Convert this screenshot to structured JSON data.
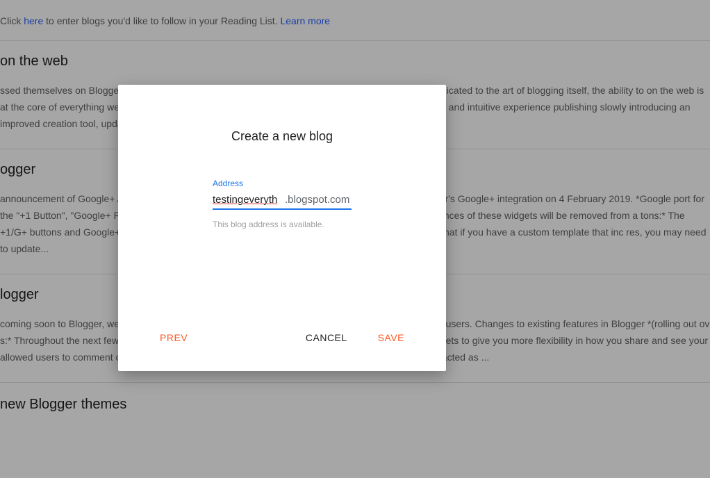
{
  "bg": {
    "hint_pre": "Click ",
    "hint_here": "here",
    "hint_mid": " to enter blogs you'd like to follow in your Reading List. ",
    "hint_learn": "Learn more",
    "h1": "on the web",
    "p1": "ssed themselves on Blogger. From detailing the simplicities of a quiet home down the lane to a blog dedicated to the art of blogging itself, the ability to on the web is at the core of everything we do. We want to make sure that whoever you are using Blogger has an easy and intuitive experience publishing slowly introducing an improved creation tool, updated settings, and a cleaner workspace. Try the New Blog...",
    "h2": "ogger",
    "p2": "announcement of Google+ APIs being shutdown, we'll be making a number of changes made to Blogger's Google+ integration on 4 February 2019. *Google port for the \"+1 Button\", \"Google+ Followers\" and \"Google+ Badge\" widgets will no longer be available. All instances of these widgets will be removed from a tons:* The +1/G+ buttons and Google+ footer share links will also be removed. These will be moved. Please note that if you have a custom template that inc res, you may need to update...",
    "h3": "logger",
    "p3": "coming soon to Blogger, we're simplifying the platform to enhance the blogging experience for all of our users. Changes to existing features in Blogger *(rolling out ov s:* Throughout the next few months, Blogger will transform Google+ widget integrations into HTML widgets to give you more flexibility in how you share and see your allowed users to comment on blogs using an existing third party OpenID identity provider and has also acted as ...",
    "h4": "new Blogger themes"
  },
  "dialog": {
    "title": "Create a new blog",
    "field_label": "Address",
    "input_value": "testingeveryth",
    "suffix": ".blogspot.com",
    "helper": "This blog address is available.",
    "prev": "PREV",
    "cancel": "CANCEL",
    "save": "SAVE"
  }
}
